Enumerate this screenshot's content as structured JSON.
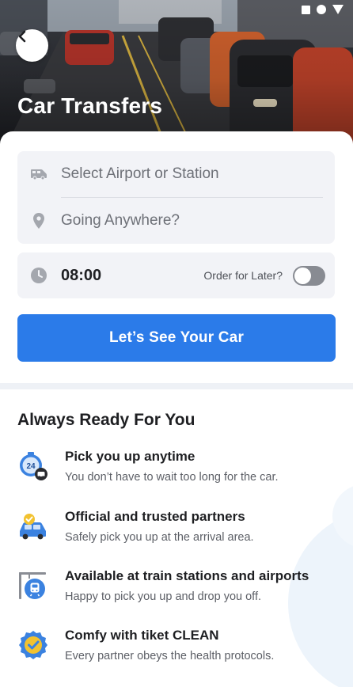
{
  "header": {
    "title": "Car Transfers"
  },
  "search": {
    "pickup_placeholder": "Select Airport or Station",
    "destination_placeholder": "Going Anywhere?",
    "time": "08:00",
    "order_later_label": "Order for Later?",
    "order_later_enabled": false,
    "submit_label": "Let’s See Your Car"
  },
  "benefits": {
    "title": "Always Ready For You",
    "items": [
      {
        "icon": "clock-24-car-icon",
        "title": "Pick you up anytime",
        "desc": "You don’t have to wait too long for the car."
      },
      {
        "icon": "trusted-partner-car-icon",
        "title": "Official and trusted partners",
        "desc": "Safely pick you up at the arrival area."
      },
      {
        "icon": "train-station-sign-icon",
        "title": "Available at train stations and airports",
        "desc": "Happy to pick you up and drop you off."
      },
      {
        "icon": "clean-badge-check-icon",
        "title": "Comfy with tiket CLEAN",
        "desc": "Every partner obeys the health protocols."
      }
    ]
  },
  "colors": {
    "primary": "#2b7be9",
    "field_bg": "#f2f3f7",
    "toggle_off": "#888b92"
  }
}
